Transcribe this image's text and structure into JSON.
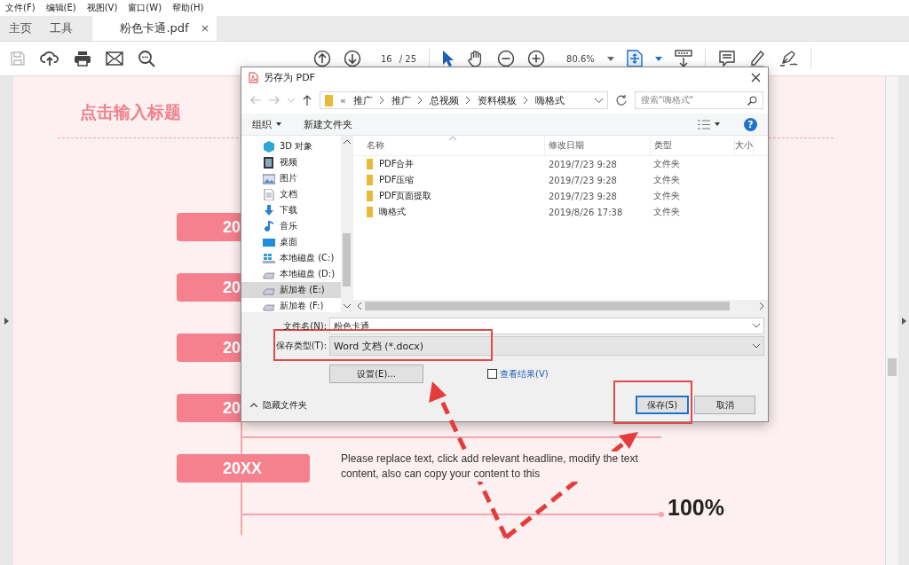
{
  "menu_bar": [
    "文件(F)",
    "编辑(E)",
    "视图(V)",
    "窗口(W)",
    "帮助(H)"
  ],
  "tabs": [
    {
      "label": "主页",
      "selected": false
    },
    {
      "label": "工具",
      "selected": false
    },
    {
      "label": "粉色卡通.pdf",
      "selected": true,
      "close": "×"
    }
  ],
  "toolbar": {
    "page_current": "16",
    "page_total": "/ 25",
    "zoom": "80.6%"
  },
  "document": {
    "title": "点击输入标题",
    "timeline": [
      "20",
      "20",
      "20",
      "20",
      "20XX"
    ],
    "paragraph": "Please replace text, click add relevant headline, modify the text content, also can copy your content to this",
    "percent": "100%"
  },
  "dialog": {
    "title": "另存为 PDF",
    "path_overflow": "«",
    "path": [
      "推广",
      "推广",
      "总视频",
      "资料模板",
      "嗨格式"
    ],
    "search_placeholder": "搜索\"嗨格式\"",
    "organize": "组织",
    "new_folder": "新建文件夹",
    "help": "?",
    "nav": [
      {
        "label": "3D 对象",
        "kind": "cube",
        "selected": false
      },
      {
        "label": "视频",
        "kind": "video",
        "selected": false
      },
      {
        "label": "图片",
        "kind": "picture",
        "selected": false
      },
      {
        "label": "文档",
        "kind": "document",
        "selected": false
      },
      {
        "label": "下载",
        "kind": "download",
        "selected": false
      },
      {
        "label": "音乐",
        "kind": "music",
        "selected": false
      },
      {
        "label": "桌面",
        "kind": "desktop",
        "selected": false
      },
      {
        "label": "本地磁盘 (C:)",
        "kind": "system-drive",
        "selected": false
      },
      {
        "label": "本地磁盘 (D:)",
        "kind": "drive",
        "selected": false
      },
      {
        "label": "新加卷 (E:)",
        "kind": "drive",
        "selected": true
      },
      {
        "label": "新加卷 (F:)",
        "kind": "drive",
        "selected": false
      }
    ],
    "columns": [
      "名称",
      "修改日期",
      "类型",
      "大小"
    ],
    "files": [
      {
        "name": "PDF合并",
        "modified": "2019/7/23 9:28",
        "type": "文件夹"
      },
      {
        "name": "PDF压缩",
        "modified": "2019/7/23 9:28",
        "type": "文件夹"
      },
      {
        "name": "PDF页面提取",
        "modified": "2019/7/23 9:28",
        "type": "文件夹"
      },
      {
        "name": "嗨格式",
        "modified": "2019/8/26 17:38",
        "type": "文件夹"
      }
    ],
    "filename_label": "文件名(N):",
    "filename": "粉色卡通",
    "type_label": "保存类型(T):",
    "type_value": "Word 文档 (*.docx)",
    "settings_button": "设置(E)...",
    "view_result": {
      "label": "查看结果(V)",
      "checked": false
    },
    "hide_folders": "隐藏文件夹",
    "buttons": [
      {
        "label": "保存(S)",
        "default": true
      },
      {
        "label": "取消",
        "default": false
      }
    ]
  }
}
